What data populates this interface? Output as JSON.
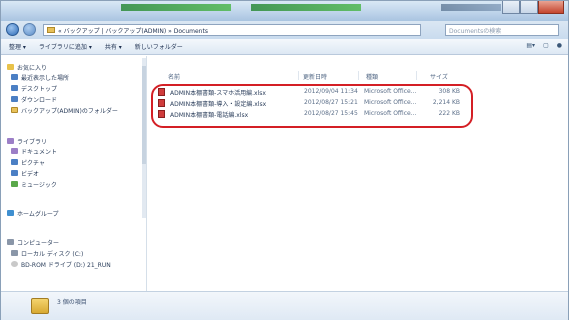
{
  "window": {
    "close_label": "×"
  },
  "address": {
    "path": "« バックアップ | バックアップ(ADMIN) » Documents",
    "search_placeholder": "Documentsの検索"
  },
  "toolbar": {
    "organize": "整理 ▾",
    "include_library": "ライブラリに追加 ▾",
    "share": "共有 ▾",
    "new_folder": "新しいフォルダー",
    "view_icon": "view-options-icon"
  },
  "nav": {
    "favorites": "お気に入り",
    "recent": "最近表示した場所",
    "desktop": "デスクトップ",
    "downloads": "ダウンロード",
    "backup_folder": "バックアップ(ADMIN)のフォルダー",
    "libraries": "ライブラリ",
    "documents": "ドキュメント",
    "pictures": "ピクチャ",
    "videos": "ビデオ",
    "music": "ミュージック",
    "homegroup": "ホームグループ",
    "computer": "コンピューター",
    "local_disk": "ローカル ディスク (C:)",
    "dvd_drive": "BD-ROM ドライブ (D:) 21_RUN"
  },
  "columns": {
    "name": "名前",
    "date": "更新日時",
    "type": "種類",
    "size": "サイズ"
  },
  "files": [
    {
      "name": "ADMIN本棚書類-スマホ活用編.xlsx",
      "date": "2012/09/04 11:34",
      "type": "Microsoft Office...",
      "size": "308 KB"
    },
    {
      "name": "ADMIN本棚書類-導入・設定編.xlsx",
      "date": "2012/08/27 15:21",
      "type": "Microsoft Office...",
      "size": "2,214 KB"
    },
    {
      "name": "ADMIN本棚書類-電話編.xlsx",
      "date": "2012/08/27 15:45",
      "type": "Microsoft Office...",
      "size": "222 KB"
    }
  ],
  "details": {
    "count": "3 個の項目"
  },
  "colors": {
    "highlight": "#d41f25"
  }
}
